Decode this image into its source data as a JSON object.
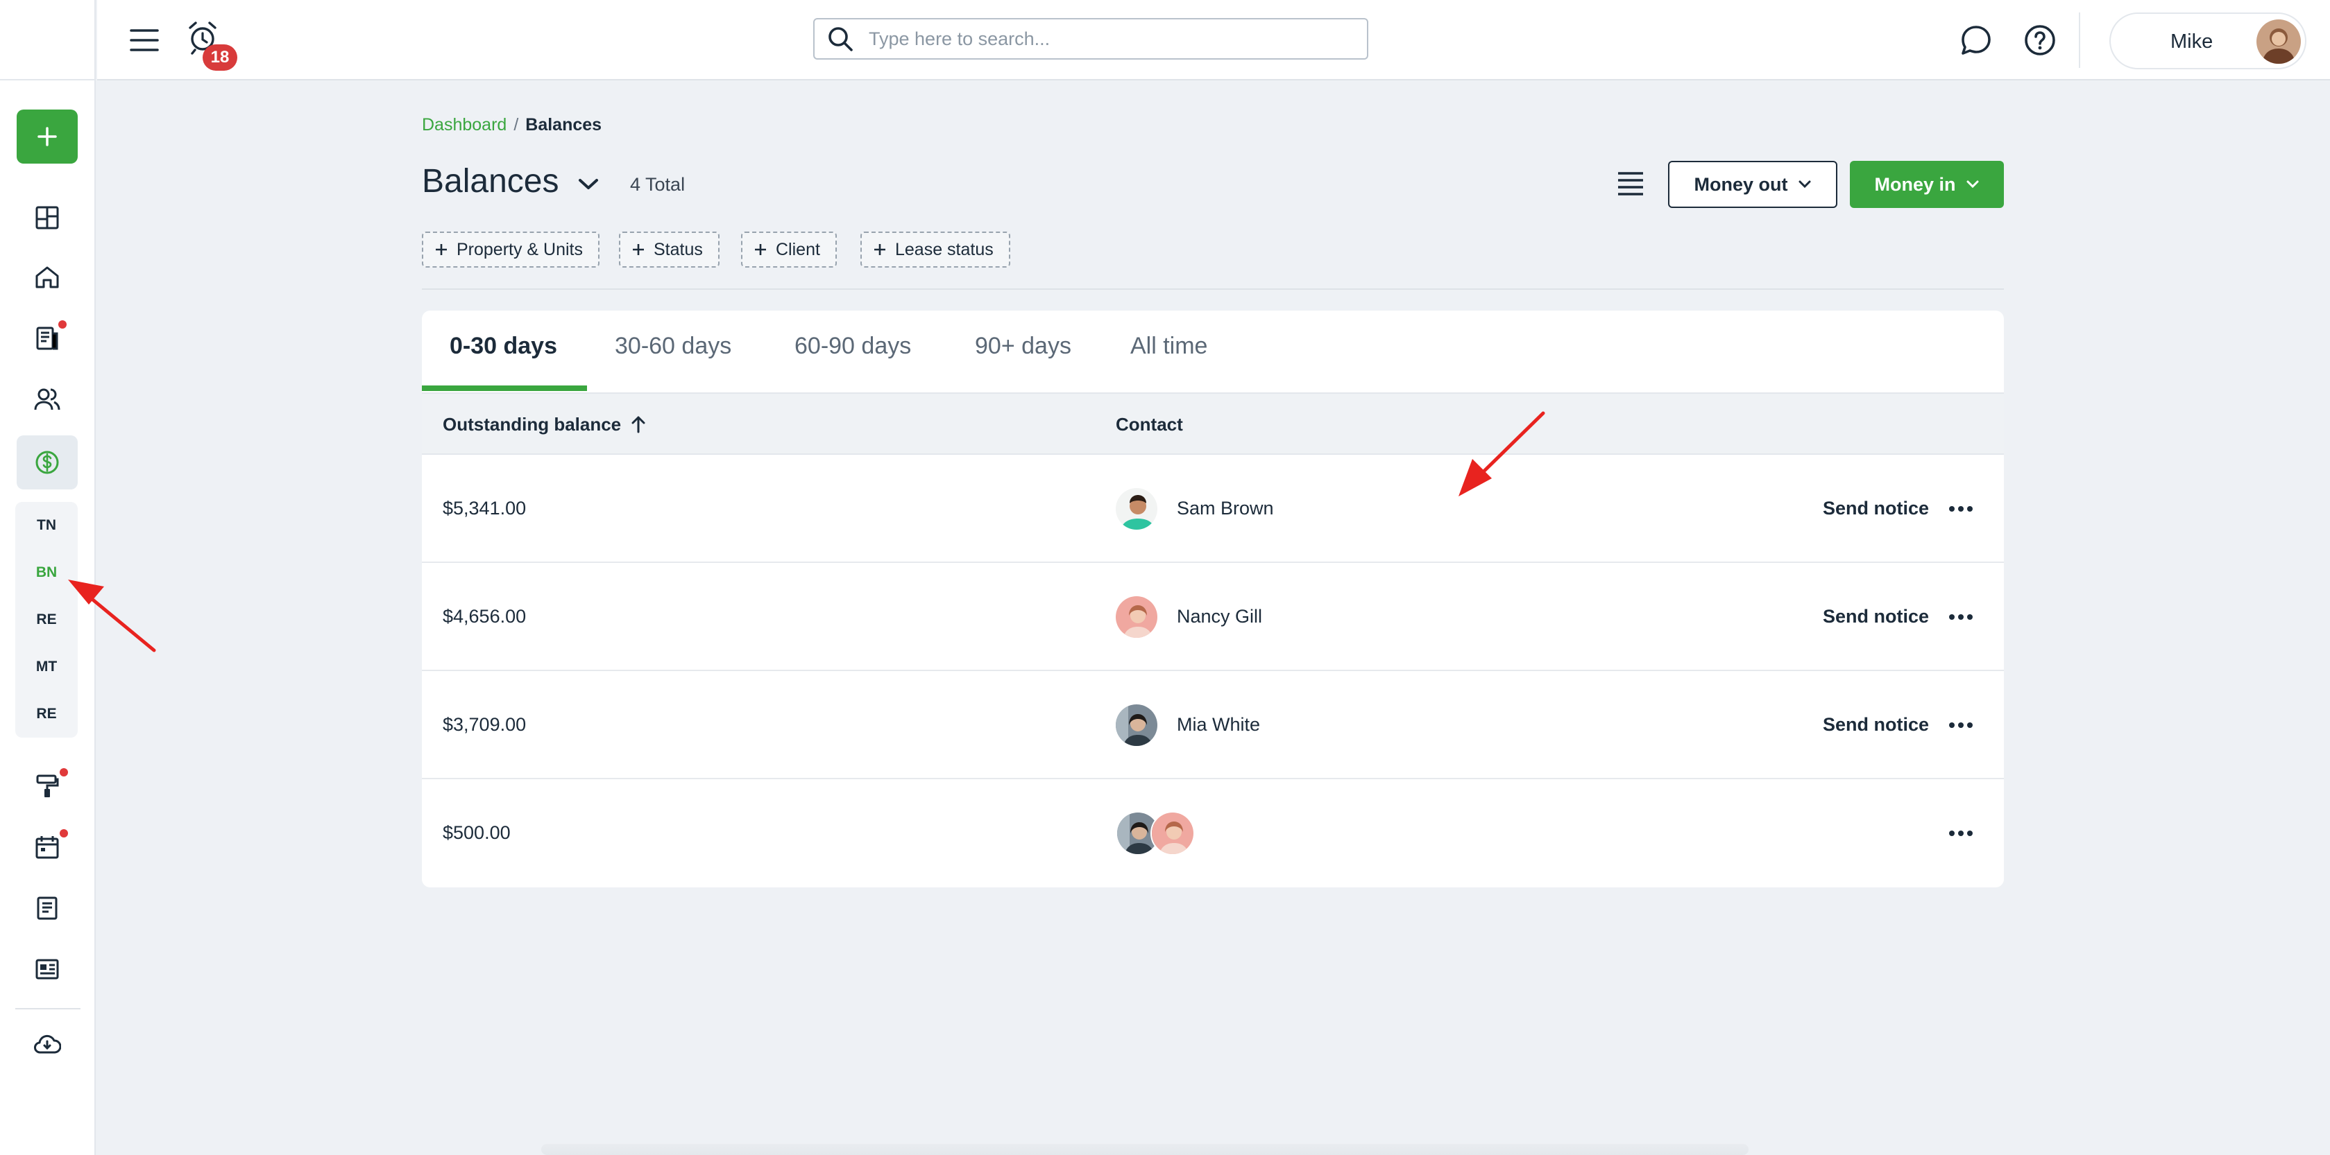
{
  "header": {
    "notification_count": "18",
    "search_placeholder": "Type here to search...",
    "user_name": "Mike"
  },
  "sidebar": {
    "sub_items": [
      "TN",
      "BN",
      "RE",
      "MT",
      "RE"
    ],
    "active_sub_item": "BN",
    "icons": [
      "plus-icon",
      "dashboard-icon",
      "home-icon",
      "documents-icon",
      "people-icon",
      "dollar-icon",
      "paint-roller-icon",
      "calendar-icon",
      "report-icon",
      "news-icon",
      "cloud-download-icon"
    ]
  },
  "breadcrumb": {
    "parent": "Dashboard",
    "separator": "/",
    "current": "Balances"
  },
  "page": {
    "title": "Balances",
    "total": "4 Total"
  },
  "actions": {
    "money_out": "Money out",
    "money_in": "Money in"
  },
  "filters": [
    "Property & Units",
    "Status",
    "Client",
    "Lease status"
  ],
  "tabs": [
    "0-30 days",
    "30-60 days",
    "60-90 days",
    "90+ days",
    "All time"
  ],
  "active_tab": "0-30 days",
  "table": {
    "columns": {
      "balance": "Outstanding balance",
      "contact": "Contact"
    },
    "rows": [
      {
        "amount": "$5,341.00",
        "contact": "Sam Brown",
        "action": "Send notice"
      },
      {
        "amount": "$4,656.00",
        "contact": "Nancy Gill",
        "action": "Send notice"
      },
      {
        "amount": "$3,709.00",
        "contact": "Mia White",
        "action": "Send notice"
      },
      {
        "amount": "$500.00",
        "contact": "",
        "action": ""
      }
    ]
  },
  "colors": {
    "brand_green": "#3aa63f",
    "badge_red": "#d83b3b",
    "annotation_red": "#e8231f"
  }
}
